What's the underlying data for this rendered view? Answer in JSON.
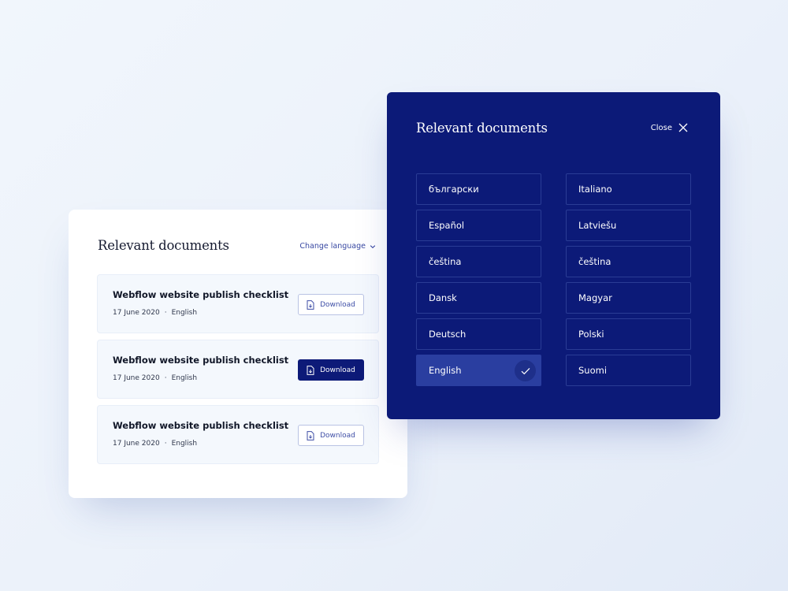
{
  "colors": {
    "primary": "#0d1a78",
    "dark_panel": "#0c1a78",
    "selected": "#2a3ea0",
    "link": "#3848a2"
  },
  "documents_card": {
    "title": "Relevant documents",
    "change_language_label": "Change language",
    "change_language_icon": "chevron-down-icon",
    "documents": [
      {
        "title": "Webflow website publish checklist",
        "date": "17 June 2020",
        "separator": "·",
        "language": "English",
        "button_label": "Download",
        "button_icon": "file-download-icon",
        "highlighted": false
      },
      {
        "title": "Webflow website publish checklist",
        "date": "17 June 2020",
        "separator": "·",
        "language": "English",
        "button_label": "Download",
        "button_icon": "file-download-icon",
        "highlighted": true
      },
      {
        "title": "Webflow website publish checklist",
        "date": "17 June 2020",
        "separator": "·",
        "language": "English",
        "button_label": "Download",
        "button_icon": "file-download-icon",
        "highlighted": false
      }
    ]
  },
  "language_modal": {
    "title": "Relevant documents",
    "close_label": "Close",
    "close_icon": "close-icon",
    "selected_icon": "checkmark-icon",
    "languages": [
      {
        "label": "български",
        "selected": false
      },
      {
        "label": "Italiano",
        "selected": false
      },
      {
        "label": "Español",
        "selected": false
      },
      {
        "label": "Latviešu",
        "selected": false
      },
      {
        "label": "čeština",
        "selected": false
      },
      {
        "label": "čeština",
        "selected": false
      },
      {
        "label": "Dansk",
        "selected": false
      },
      {
        "label": "Magyar",
        "selected": false
      },
      {
        "label": "Deutsch",
        "selected": false
      },
      {
        "label": "Polski",
        "selected": false
      },
      {
        "label": "English",
        "selected": true
      },
      {
        "label": "Suomi",
        "selected": false
      }
    ]
  }
}
